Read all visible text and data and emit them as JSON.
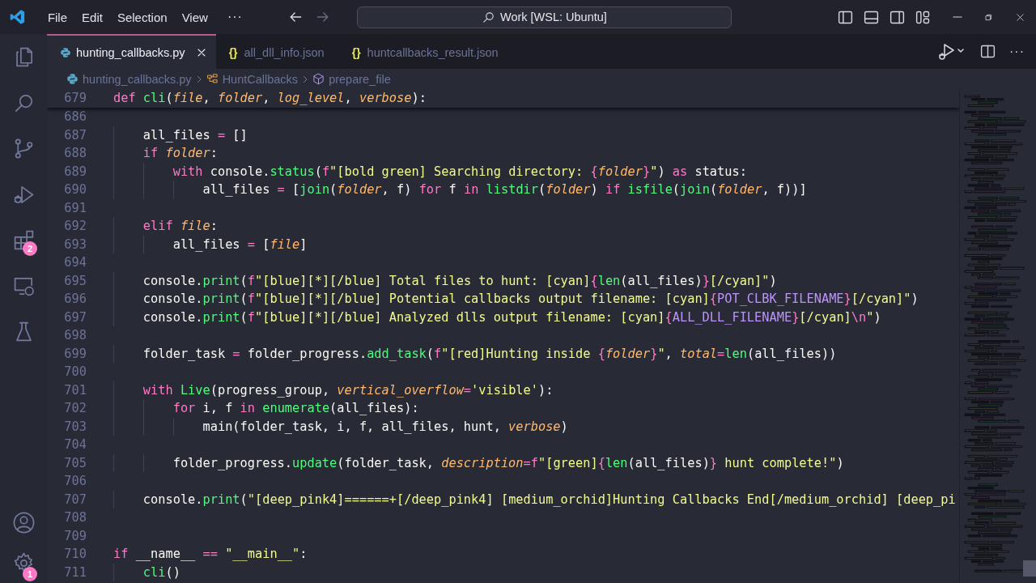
{
  "title_bar": {
    "menus": [
      "File",
      "Edit",
      "Selection",
      "View"
    ],
    "more": "···",
    "nav": [
      {
        "kind": "back",
        "disabled": false
      },
      {
        "kind": "forward",
        "disabled": true
      }
    ],
    "command_center": "Work [WSL: Ubuntu]",
    "layout_buttons": [
      {
        "kind": "primary-sidebar"
      },
      {
        "kind": "panel"
      },
      {
        "kind": "secondary-sidebar"
      },
      {
        "kind": "customize"
      }
    ],
    "window_buttons": [
      {
        "kind": "minimize"
      },
      {
        "kind": "restore"
      },
      {
        "kind": "close"
      }
    ]
  },
  "activity_bar": {
    "top": [
      {
        "kind": "explorer"
      },
      {
        "kind": "search"
      },
      {
        "kind": "source-control"
      },
      {
        "kind": "run-debug"
      },
      {
        "kind": "extensions",
        "badge": "2"
      },
      {
        "kind": "remote"
      },
      {
        "kind": "testing"
      }
    ],
    "bottom": [
      {
        "kind": "account"
      },
      {
        "kind": "settings",
        "badge": "1"
      }
    ]
  },
  "tabs": [
    {
      "kind": "python",
      "label": "hunting_callbacks.py",
      "selected": true
    },
    {
      "kind": "json",
      "icon": "{}",
      "label": "all_dll_info.json",
      "selected": false
    },
    {
      "kind": "json",
      "icon": "{}",
      "label": "huntcallbacks_result.json",
      "selected": false
    }
  ],
  "editor_actions": [
    {
      "kind": "run-debug"
    },
    {
      "kind": "split"
    },
    {
      "kind": "more",
      "text": "···"
    }
  ],
  "breadcrumbs": [
    {
      "kind": "file",
      "label": "hunting_callbacks.py"
    },
    {
      "kind": "class",
      "label": "HuntCallbacks"
    },
    {
      "kind": "method",
      "label": "prepare_file"
    }
  ],
  "sticky_line": {
    "number": "679",
    "tokens": [
      {
        "kind": "kw",
        "text": "def "
      },
      {
        "kind": "fn",
        "text": "cli"
      },
      {
        "kind": "plain",
        "text": "("
      },
      {
        "kind": "param",
        "text": "file"
      },
      {
        "kind": "plain",
        "text": ", "
      },
      {
        "kind": "param",
        "text": "folder"
      },
      {
        "kind": "plain",
        "text": ", "
      },
      {
        "kind": "param",
        "text": "log_level"
      },
      {
        "kind": "plain",
        "text": ", "
      },
      {
        "kind": "param",
        "text": "verbose"
      },
      {
        "kind": "plain",
        "text": "):"
      }
    ]
  },
  "lines": [
    {
      "number": "686"
    },
    {
      "number": "687",
      "tokens": [
        {
          "kind": "plain",
          "text": "    all_files "
        },
        {
          "kind": "op",
          "text": "="
        },
        {
          "kind": "plain",
          "text": " []"
        }
      ]
    },
    {
      "number": "688",
      "tokens": [
        {
          "kind": "kw",
          "text": "    if "
        },
        {
          "kind": "param",
          "text": "folder"
        },
        {
          "kind": "plain",
          "text": ":"
        }
      ]
    },
    {
      "number": "689",
      "tokens": [
        {
          "kind": "kw",
          "text": "        with"
        },
        {
          "kind": "plain",
          "text": " console."
        },
        {
          "kind": "fn",
          "text": "status"
        },
        {
          "kind": "plain",
          "text": "("
        },
        {
          "kind": "kw",
          "text": "f"
        },
        {
          "kind": "str",
          "text": "\"[bold green] Searching directory: "
        },
        {
          "kind": "op",
          "text": "{"
        },
        {
          "kind": "param",
          "text": "folder"
        },
        {
          "kind": "op",
          "text": "}"
        },
        {
          "kind": "str",
          "text": "\""
        },
        {
          "kind": "plain",
          "text": ") "
        },
        {
          "kind": "kw",
          "text": "as"
        },
        {
          "kind": "plain",
          "text": " status:"
        }
      ]
    },
    {
      "number": "690",
      "tokens": [
        {
          "kind": "plain",
          "text": "            all_files "
        },
        {
          "kind": "op",
          "text": "="
        },
        {
          "kind": "plain",
          "text": " ["
        },
        {
          "kind": "fn",
          "text": "join"
        },
        {
          "kind": "plain",
          "text": "("
        },
        {
          "kind": "param",
          "text": "folder"
        },
        {
          "kind": "plain",
          "text": ", f) "
        },
        {
          "kind": "kw",
          "text": "for"
        },
        {
          "kind": "plain",
          "text": " f "
        },
        {
          "kind": "kw",
          "text": "in "
        },
        {
          "kind": "fn",
          "text": "listdir"
        },
        {
          "kind": "plain",
          "text": "("
        },
        {
          "kind": "param",
          "text": "folder"
        },
        {
          "kind": "plain",
          "text": ") "
        },
        {
          "kind": "kw",
          "text": "if "
        },
        {
          "kind": "fn",
          "text": "isfile"
        },
        {
          "kind": "plain",
          "text": "("
        },
        {
          "kind": "fn",
          "text": "join"
        },
        {
          "kind": "plain",
          "text": "("
        },
        {
          "kind": "param",
          "text": "folder"
        },
        {
          "kind": "plain",
          "text": ", f))]"
        }
      ]
    },
    {
      "number": "691"
    },
    {
      "number": "692",
      "tokens": [
        {
          "kind": "kw",
          "text": "    elif "
        },
        {
          "kind": "param",
          "text": "file"
        },
        {
          "kind": "plain",
          "text": ":"
        }
      ]
    },
    {
      "number": "693",
      "tokens": [
        {
          "kind": "plain",
          "text": "        all_files "
        },
        {
          "kind": "op",
          "text": "="
        },
        {
          "kind": "plain",
          "text": " ["
        },
        {
          "kind": "param",
          "text": "file"
        },
        {
          "kind": "plain",
          "text": "]"
        }
      ]
    },
    {
      "number": "694"
    },
    {
      "number": "695",
      "tokens": [
        {
          "kind": "plain",
          "text": "    console."
        },
        {
          "kind": "fn",
          "text": "print"
        },
        {
          "kind": "plain",
          "text": "("
        },
        {
          "kind": "kw",
          "text": "f"
        },
        {
          "kind": "str",
          "text": "\"[blue][*][/blue] Total files to hunt: [cyan]"
        },
        {
          "kind": "op",
          "text": "{"
        },
        {
          "kind": "fn",
          "text": "len"
        },
        {
          "kind": "plain",
          "text": "(all_files)"
        },
        {
          "kind": "op",
          "text": "}"
        },
        {
          "kind": "str",
          "text": "[/cyan]\""
        },
        {
          "kind": "plain",
          "text": ")"
        }
      ]
    },
    {
      "number": "696",
      "tokens": [
        {
          "kind": "plain",
          "text": "    console."
        },
        {
          "kind": "fn",
          "text": "print"
        },
        {
          "kind": "plain",
          "text": "("
        },
        {
          "kind": "kw",
          "text": "f"
        },
        {
          "kind": "str",
          "text": "\"[blue][*][/blue] Potential callbacks output filename: [cyan]"
        },
        {
          "kind": "op",
          "text": "{"
        },
        {
          "kind": "const",
          "text": "POT_CLBK_FILENAME"
        },
        {
          "kind": "op",
          "text": "}"
        },
        {
          "kind": "str",
          "text": "[/cyan]\""
        },
        {
          "kind": "plain",
          "text": ")"
        }
      ]
    },
    {
      "number": "697",
      "tokens": [
        {
          "kind": "plain",
          "text": "    console."
        },
        {
          "kind": "fn",
          "text": "print"
        },
        {
          "kind": "plain",
          "text": "("
        },
        {
          "kind": "kw",
          "text": "f"
        },
        {
          "kind": "str",
          "text": "\"[blue][*][/blue] Analyzed dlls output filename: [cyan]"
        },
        {
          "kind": "op",
          "text": "{"
        },
        {
          "kind": "const",
          "text": "ALL_DLL_FILENAME"
        },
        {
          "kind": "op",
          "text": "}"
        },
        {
          "kind": "str",
          "text": "[/cyan]"
        },
        {
          "kind": "op",
          "text": "\\n"
        },
        {
          "kind": "str",
          "text": "\""
        },
        {
          "kind": "plain",
          "text": ")"
        }
      ]
    },
    {
      "number": "698"
    },
    {
      "number": "699",
      "tokens": [
        {
          "kind": "plain",
          "text": "    folder_task "
        },
        {
          "kind": "op",
          "text": "="
        },
        {
          "kind": "plain",
          "text": " folder_progress."
        },
        {
          "kind": "fn",
          "text": "add_task"
        },
        {
          "kind": "plain",
          "text": "("
        },
        {
          "kind": "kw",
          "text": "f"
        },
        {
          "kind": "str",
          "text": "\"[red]Hunting inside "
        },
        {
          "kind": "op",
          "text": "{"
        },
        {
          "kind": "param",
          "text": "folder"
        },
        {
          "kind": "op",
          "text": "}"
        },
        {
          "kind": "str",
          "text": "\""
        },
        {
          "kind": "plain",
          "text": ", "
        },
        {
          "kind": "param",
          "text": "total"
        },
        {
          "kind": "op",
          "text": "="
        },
        {
          "kind": "fn",
          "text": "len"
        },
        {
          "kind": "plain",
          "text": "(all_files))"
        }
      ]
    },
    {
      "number": "700"
    },
    {
      "number": "701",
      "tokens": [
        {
          "kind": "kw",
          "text": "    with "
        },
        {
          "kind": "fn",
          "text": "Live"
        },
        {
          "kind": "plain",
          "text": "(progress_group, "
        },
        {
          "kind": "param",
          "text": "vertical_overflow"
        },
        {
          "kind": "op",
          "text": "="
        },
        {
          "kind": "str",
          "text": "'visible'"
        },
        {
          "kind": "plain",
          "text": "):"
        }
      ]
    },
    {
      "number": "702",
      "tokens": [
        {
          "kind": "kw",
          "text": "        for"
        },
        {
          "kind": "plain",
          "text": " i, f "
        },
        {
          "kind": "kw",
          "text": "in "
        },
        {
          "kind": "fn",
          "text": "enumerate"
        },
        {
          "kind": "plain",
          "text": "(all_files):"
        }
      ]
    },
    {
      "number": "703",
      "tokens": [
        {
          "kind": "plain",
          "text": "            main(folder_task, i, f, all_files, hunt, "
        },
        {
          "kind": "param",
          "text": "verbose"
        },
        {
          "kind": "plain",
          "text": ")"
        }
      ]
    },
    {
      "number": "704"
    },
    {
      "number": "705",
      "tokens": [
        {
          "kind": "plain",
          "text": "        folder_progress."
        },
        {
          "kind": "fn",
          "text": "update"
        },
        {
          "kind": "plain",
          "text": "(folder_task, "
        },
        {
          "kind": "param",
          "text": "description"
        },
        {
          "kind": "op",
          "text": "="
        },
        {
          "kind": "kw",
          "text": "f"
        },
        {
          "kind": "str",
          "text": "\"[green]"
        },
        {
          "kind": "op",
          "text": "{"
        },
        {
          "kind": "fn",
          "text": "len"
        },
        {
          "kind": "plain",
          "text": "(all_files)"
        },
        {
          "kind": "op",
          "text": "}"
        },
        {
          "kind": "str",
          "text": " hunt complete!\""
        },
        {
          "kind": "plain",
          "text": ")"
        }
      ]
    },
    {
      "number": "706"
    },
    {
      "number": "707",
      "tokens": [
        {
          "kind": "plain",
          "text": "    console."
        },
        {
          "kind": "fn",
          "text": "print"
        },
        {
          "kind": "plain",
          "text": "("
        },
        {
          "kind": "str",
          "text": "\"[deep_pink4]======+[/deep_pink4] [medium_orchid]Hunting Callbacks End[/medium_orchid] [deep_pi"
        }
      ]
    },
    {
      "number": "708"
    },
    {
      "number": "709"
    },
    {
      "number": "710",
      "tokens": [
        {
          "kind": "kw",
          "text": "if"
        },
        {
          "kind": "plain",
          "text": " __name__ "
        },
        {
          "kind": "op",
          "text": "=="
        },
        {
          "kind": "str",
          "text": " \"__main__\""
        },
        {
          "kind": "plain",
          "text": ":"
        }
      ]
    },
    {
      "number": "711",
      "tokens": [
        {
          "kind": "fn",
          "text": "    cli"
        },
        {
          "kind": "plain",
          "text": "()"
        }
      ]
    }
  ]
}
